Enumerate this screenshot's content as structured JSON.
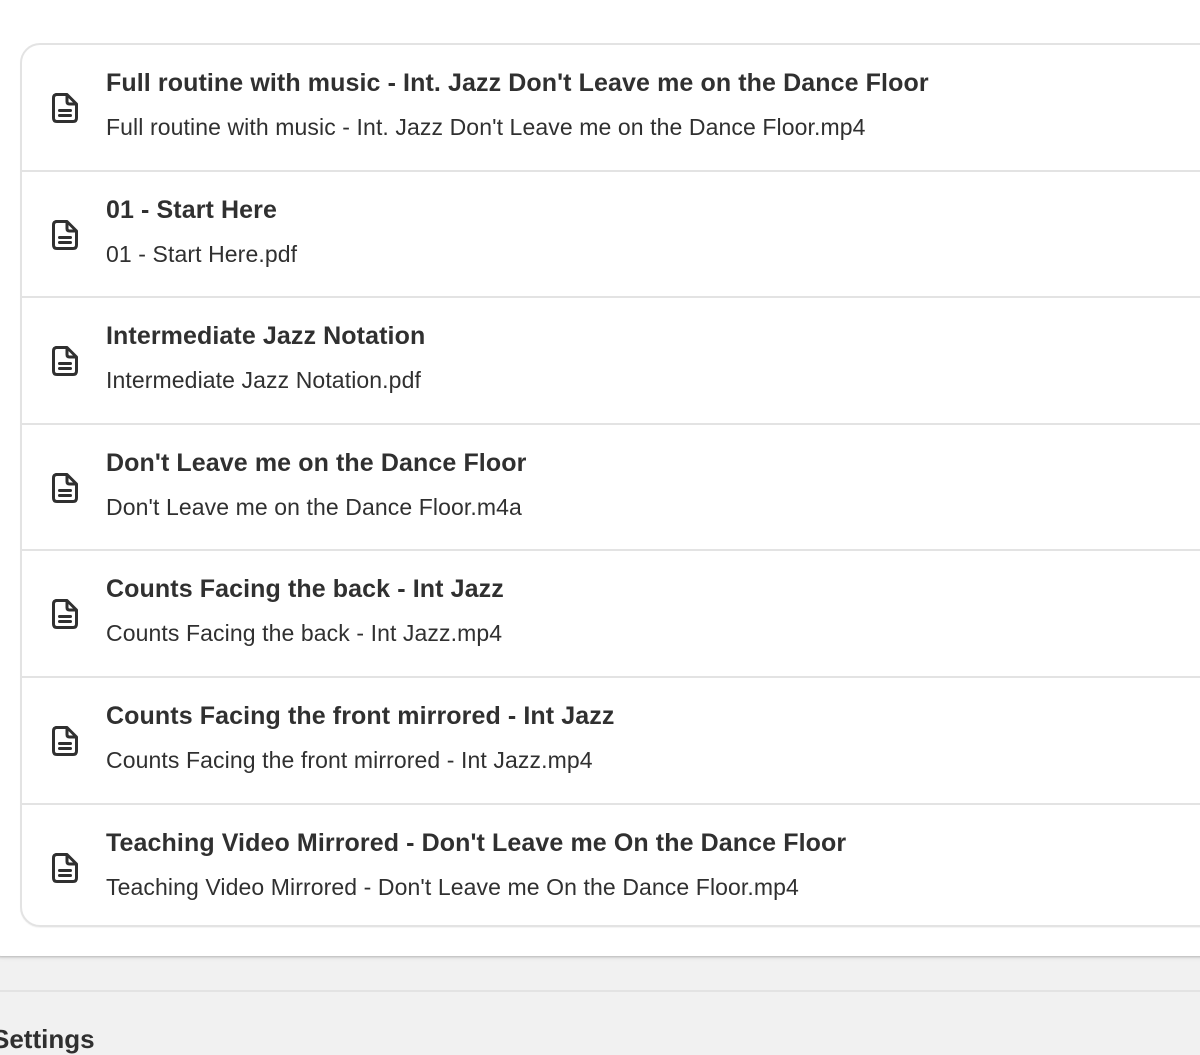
{
  "files": [
    {
      "title": "Full routine with music - Int. Jazz Don't Leave me on the Dance Floor",
      "filename": "Full routine with music - Int. Jazz Don't Leave me on the Dance Floor.mp4",
      "icon": "file-icon"
    },
    {
      "title": "01 - Start Here",
      "filename": "01 - Start Here.pdf",
      "icon": "file-icon"
    },
    {
      "title": "Intermediate Jazz Notation",
      "filename": "Intermediate Jazz Notation.pdf",
      "icon": "file-icon"
    },
    {
      "title": "Don't Leave me on the Dance Floor",
      "filename": "Don't Leave me on the Dance Floor.m4a",
      "icon": "file-icon"
    },
    {
      "title": "Counts Facing the back - Int Jazz",
      "filename": "Counts Facing the back - Int Jazz.mp4",
      "icon": "file-icon"
    },
    {
      "title": "Counts Facing the front mirrored - Int Jazz",
      "filename": "Counts Facing the front mirrored - Int Jazz.mp4",
      "icon": "file-icon"
    },
    {
      "title": "Teaching Video Mirrored - Don't Leave me On the Dance Floor",
      "filename": "Teaching Video Mirrored - Don't Leave me On the Dance Floor.mp4",
      "icon": "file-icon"
    }
  ],
  "settings": {
    "heading": "Settings"
  },
  "colors": {
    "page_background": "#f1f1f1",
    "card_background": "#ffffff",
    "border": "#e3e3e3",
    "text": "#303030"
  }
}
